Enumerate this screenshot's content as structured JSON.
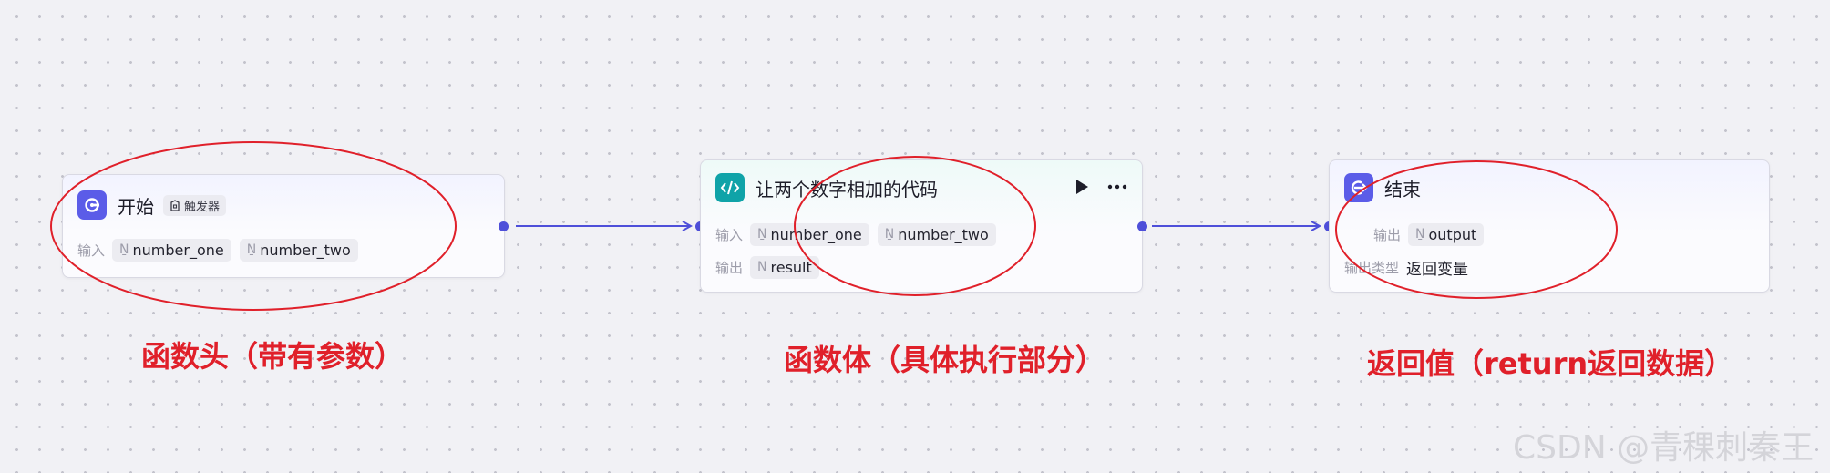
{
  "nodes": {
    "start": {
      "title": "开始",
      "badge": "触发器",
      "input_label": "输入",
      "inputs": [
        {
          "type": "Ṉ",
          "name": "number_one"
        },
        {
          "type": "Ṉ",
          "name": "number_two"
        }
      ]
    },
    "code": {
      "title": "让两个数字相加的代码",
      "input_label": "输入",
      "output_label": "输出",
      "inputs": [
        {
          "type": "Ṉ",
          "name": "number_one"
        },
        {
          "type": "Ṉ",
          "name": "number_two"
        }
      ],
      "outputs": [
        {
          "type": "Ṉ",
          "name": "result"
        }
      ]
    },
    "end": {
      "title": "结束",
      "output_label": "输出",
      "outputs": [
        {
          "type": "Ṉ",
          "name": "output"
        }
      ],
      "output_type_label": "输出类型",
      "output_type_value": "返回变量"
    }
  },
  "annotations": {
    "start": "函数头（带有参数）",
    "code": "函数体（具体执行部分）",
    "end": "返回值（return返回数据）"
  },
  "watermark": "CSDN @青稞刺秦王",
  "colors": {
    "annotation": "#e0202a",
    "edge": "#4e4fd9",
    "start_icon": "#5b5ce8",
    "code_icon": "#0fa3a8",
    "end_icon": "#5b5ce8"
  },
  "icons": {
    "start": "start-icon",
    "code": "code-icon",
    "end": "end-icon",
    "run": "play-icon",
    "more": "more-icon",
    "trigger": "trigger-icon"
  }
}
